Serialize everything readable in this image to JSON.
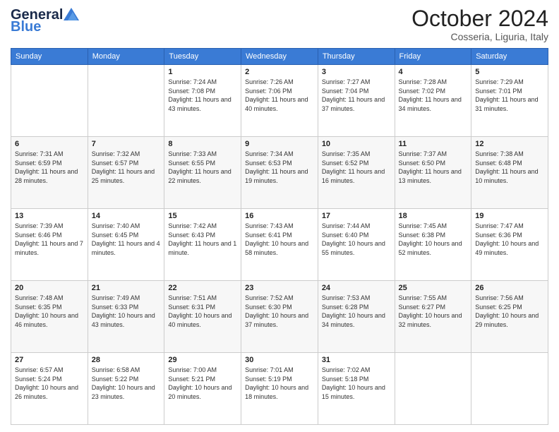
{
  "header": {
    "logo_line1": "General",
    "logo_line2": "Blue",
    "month_year": "October 2024",
    "location": "Cosseria, Liguria, Italy"
  },
  "days_of_week": [
    "Sunday",
    "Monday",
    "Tuesday",
    "Wednesday",
    "Thursday",
    "Friday",
    "Saturday"
  ],
  "weeks": [
    [
      {
        "num": "",
        "info": ""
      },
      {
        "num": "",
        "info": ""
      },
      {
        "num": "1",
        "info": "Sunrise: 7:24 AM\nSunset: 7:08 PM\nDaylight: 11 hours and 43 minutes."
      },
      {
        "num": "2",
        "info": "Sunrise: 7:26 AM\nSunset: 7:06 PM\nDaylight: 11 hours and 40 minutes."
      },
      {
        "num": "3",
        "info": "Sunrise: 7:27 AM\nSunset: 7:04 PM\nDaylight: 11 hours and 37 minutes."
      },
      {
        "num": "4",
        "info": "Sunrise: 7:28 AM\nSunset: 7:02 PM\nDaylight: 11 hours and 34 minutes."
      },
      {
        "num": "5",
        "info": "Sunrise: 7:29 AM\nSunset: 7:01 PM\nDaylight: 11 hours and 31 minutes."
      }
    ],
    [
      {
        "num": "6",
        "info": "Sunrise: 7:31 AM\nSunset: 6:59 PM\nDaylight: 11 hours and 28 minutes."
      },
      {
        "num": "7",
        "info": "Sunrise: 7:32 AM\nSunset: 6:57 PM\nDaylight: 11 hours and 25 minutes."
      },
      {
        "num": "8",
        "info": "Sunrise: 7:33 AM\nSunset: 6:55 PM\nDaylight: 11 hours and 22 minutes."
      },
      {
        "num": "9",
        "info": "Sunrise: 7:34 AM\nSunset: 6:53 PM\nDaylight: 11 hours and 19 minutes."
      },
      {
        "num": "10",
        "info": "Sunrise: 7:35 AM\nSunset: 6:52 PM\nDaylight: 11 hours and 16 minutes."
      },
      {
        "num": "11",
        "info": "Sunrise: 7:37 AM\nSunset: 6:50 PM\nDaylight: 11 hours and 13 minutes."
      },
      {
        "num": "12",
        "info": "Sunrise: 7:38 AM\nSunset: 6:48 PM\nDaylight: 11 hours and 10 minutes."
      }
    ],
    [
      {
        "num": "13",
        "info": "Sunrise: 7:39 AM\nSunset: 6:46 PM\nDaylight: 11 hours and 7 minutes."
      },
      {
        "num": "14",
        "info": "Sunrise: 7:40 AM\nSunset: 6:45 PM\nDaylight: 11 hours and 4 minutes."
      },
      {
        "num": "15",
        "info": "Sunrise: 7:42 AM\nSunset: 6:43 PM\nDaylight: 11 hours and 1 minute."
      },
      {
        "num": "16",
        "info": "Sunrise: 7:43 AM\nSunset: 6:41 PM\nDaylight: 10 hours and 58 minutes."
      },
      {
        "num": "17",
        "info": "Sunrise: 7:44 AM\nSunset: 6:40 PM\nDaylight: 10 hours and 55 minutes."
      },
      {
        "num": "18",
        "info": "Sunrise: 7:45 AM\nSunset: 6:38 PM\nDaylight: 10 hours and 52 minutes."
      },
      {
        "num": "19",
        "info": "Sunrise: 7:47 AM\nSunset: 6:36 PM\nDaylight: 10 hours and 49 minutes."
      }
    ],
    [
      {
        "num": "20",
        "info": "Sunrise: 7:48 AM\nSunset: 6:35 PM\nDaylight: 10 hours and 46 minutes."
      },
      {
        "num": "21",
        "info": "Sunrise: 7:49 AM\nSunset: 6:33 PM\nDaylight: 10 hours and 43 minutes."
      },
      {
        "num": "22",
        "info": "Sunrise: 7:51 AM\nSunset: 6:31 PM\nDaylight: 10 hours and 40 minutes."
      },
      {
        "num": "23",
        "info": "Sunrise: 7:52 AM\nSunset: 6:30 PM\nDaylight: 10 hours and 37 minutes."
      },
      {
        "num": "24",
        "info": "Sunrise: 7:53 AM\nSunset: 6:28 PM\nDaylight: 10 hours and 34 minutes."
      },
      {
        "num": "25",
        "info": "Sunrise: 7:55 AM\nSunset: 6:27 PM\nDaylight: 10 hours and 32 minutes."
      },
      {
        "num": "26",
        "info": "Sunrise: 7:56 AM\nSunset: 6:25 PM\nDaylight: 10 hours and 29 minutes."
      }
    ],
    [
      {
        "num": "27",
        "info": "Sunrise: 6:57 AM\nSunset: 5:24 PM\nDaylight: 10 hours and 26 minutes."
      },
      {
        "num": "28",
        "info": "Sunrise: 6:58 AM\nSunset: 5:22 PM\nDaylight: 10 hours and 23 minutes."
      },
      {
        "num": "29",
        "info": "Sunrise: 7:00 AM\nSunset: 5:21 PM\nDaylight: 10 hours and 20 minutes."
      },
      {
        "num": "30",
        "info": "Sunrise: 7:01 AM\nSunset: 5:19 PM\nDaylight: 10 hours and 18 minutes."
      },
      {
        "num": "31",
        "info": "Sunrise: 7:02 AM\nSunset: 5:18 PM\nDaylight: 10 hours and 15 minutes."
      },
      {
        "num": "",
        "info": ""
      },
      {
        "num": "",
        "info": ""
      }
    ]
  ]
}
